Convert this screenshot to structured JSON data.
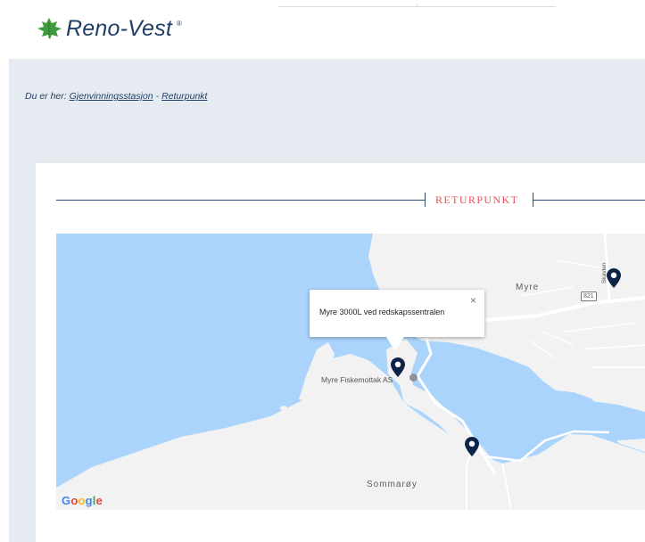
{
  "brand": {
    "name": "Reno-Vest",
    "reg_mark": "®"
  },
  "breadcrumb": {
    "prefix": "Du er her:",
    "links": [
      "Gjenvinningsstasjon",
      "Returpunkt"
    ],
    "separator": "-"
  },
  "section": {
    "title": "RETURPUNKT"
  },
  "map": {
    "places": {
      "myre": "Myre",
      "sommaroy": "Sommarøy"
    },
    "road_number": "821",
    "street": "Skavten",
    "poi": "Myre Fiskemottak AS",
    "infowindow": {
      "text": "Myre 3000L ved redskapssentralen",
      "close": "×"
    },
    "attribution": "Google",
    "colors": {
      "water": "#aad4fb",
      "land": "#f2f2f2",
      "pin": "#0e2348"
    }
  },
  "colors": {
    "accent": "#e2515a",
    "navy": "#1f3f66",
    "panel": "#e6ebf2"
  }
}
